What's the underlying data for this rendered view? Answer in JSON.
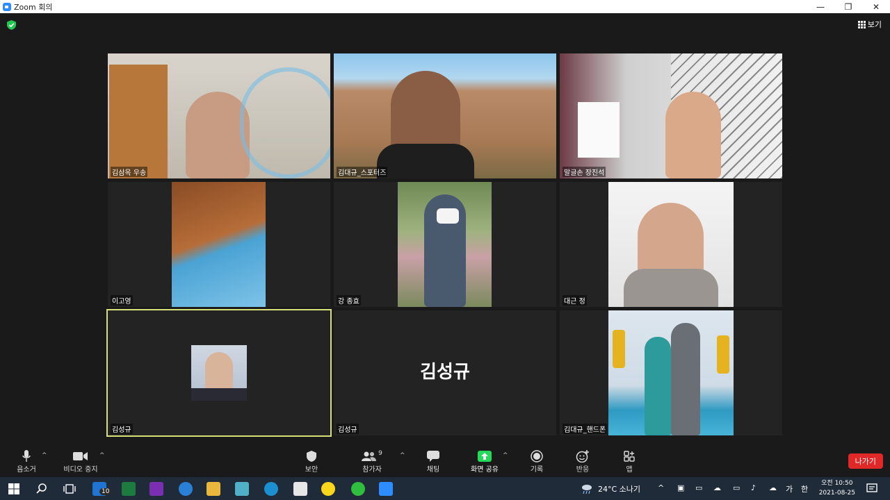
{
  "window": {
    "title": "Zoom 회의",
    "minimize": "—",
    "maximize": "❐",
    "close": "✕"
  },
  "view_button": "보기",
  "tiles": [
    {
      "name": "김삼옥 우송"
    },
    {
      "name": "김대규_스포터즈"
    },
    {
      "name": "말글손 장진석"
    },
    {
      "name": "이고영"
    },
    {
      "name": "강 종효"
    },
    {
      "name": "대근 정"
    },
    {
      "name": "김성규"
    },
    {
      "name": "김성규",
      "big_label": "김성규"
    },
    {
      "name": "김대규_핸드폰"
    }
  ],
  "toolbar": {
    "mute": "음소거",
    "video_stop": "비디오 중지",
    "security": "보안",
    "participants": "참가자",
    "participants_count": "9",
    "chat": "채팅",
    "share_screen": "화면 공유",
    "record": "기록",
    "reactions": "반응",
    "apps": "앱",
    "leave": "나가기"
  },
  "taskbar": {
    "mail_badge": "10",
    "weather": "24°C 소나기",
    "ime_ga": "가",
    "ime_han": "한",
    "time": "오전 10:50",
    "date": "2021-08-25"
  },
  "colors": {
    "accent": "#2d8cff",
    "active_border": "#d9e27a",
    "leave": "#e02828",
    "share_green": "#23d959"
  }
}
